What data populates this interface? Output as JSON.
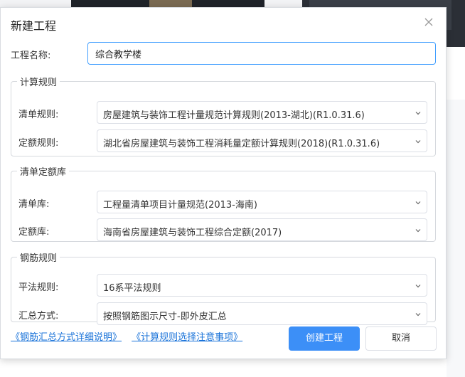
{
  "dialog": {
    "title": "新建工程",
    "close_icon": "close-icon"
  },
  "project_name": {
    "label": "工程名称:",
    "value": "综合教学楼"
  },
  "calc_rules": {
    "legend": "计算规则",
    "bill_rule": {
      "label": "清单规则:",
      "value": "房屋建筑与装饰工程计量规范计算规则(2013-湖北)(R1.0.31.6)"
    },
    "quota_rule": {
      "label": "定额规则:",
      "value": "湖北省房屋建筑与装饰工程消耗量定额计算规则(2018)(R1.0.31.6)"
    }
  },
  "libraries": {
    "legend": "清单定额库",
    "bill_lib": {
      "label": "清单库:",
      "value": "工程量清单项目计量规范(2013-海南)"
    },
    "quota_lib": {
      "label": "定额库:",
      "value": "海南省房屋建筑与装饰工程综合定额(2017)"
    }
  },
  "rebar_rules": {
    "legend": "钢筋规则",
    "flat_rule": {
      "label": "平法规则:",
      "value": "16系平法规则"
    },
    "summary_method": {
      "label": "汇总方式:",
      "value": "按照钢筋图示尺寸-即外皮汇总"
    }
  },
  "footer": {
    "link_rebar_summary": "《钢筋汇总方式详细说明》",
    "link_calc_notes": "《计算规则选择注意事项》",
    "create_button": "创建工程",
    "cancel_button": "取消"
  },
  "colors": {
    "primary": "#3c8ff7",
    "link": "#1a73d9",
    "input_focus_border": "#409eff"
  }
}
